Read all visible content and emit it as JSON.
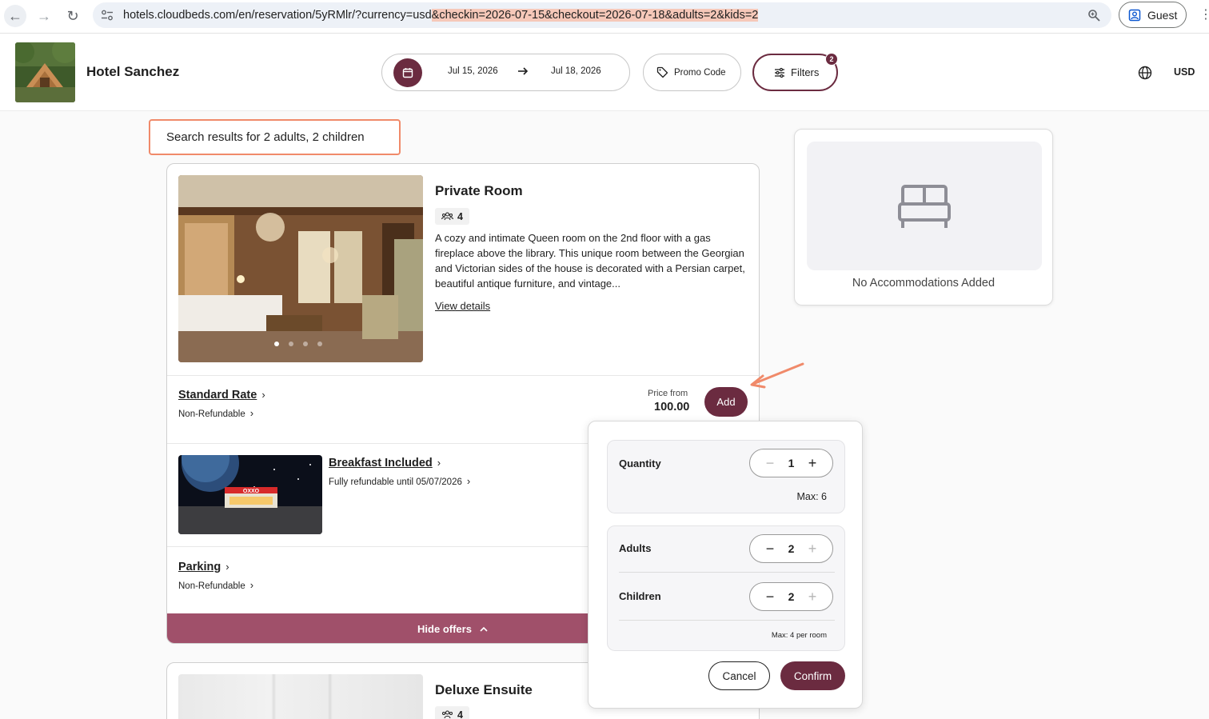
{
  "browser": {
    "url_plain": "hotels.cloudbeds.com/en/reservation/5yRMlr/?currency=usd",
    "url_highlight": "&checkin=2026-07-15&checkout=2026-07-18&adults=2&kids=2",
    "profile_label": "Guest"
  },
  "header": {
    "hotel_name": "Hotel Sanchez",
    "checkin": "Jul 15, 2026",
    "checkout": "Jul 18, 2026",
    "promo_label": "Promo Code",
    "filters_label": "Filters",
    "filters_count": "2",
    "currency": "USD"
  },
  "results": {
    "label": "Search results for 2 adults, 2 children"
  },
  "rooms": [
    {
      "title": "Private Room",
      "occupancy": "4",
      "description": "A cozy and intimate Queen room on the 2nd floor with a gas fireplace above the library. This unique room between the Georgian and Victorian sides of the house is decorated with a Persian carpet, beautiful antique furniture, and vintage...",
      "view_details": "View details",
      "offers": [
        {
          "name": "Standard Rate",
          "policy": "Non-Refundable",
          "price_label": "Price from",
          "price": "100.00",
          "add_label": "Add"
        },
        {
          "name": "Breakfast Included",
          "policy": "Fully refundable until 05/07/2026",
          "photo_sign": "OXXO"
        },
        {
          "name": "Parking",
          "policy": "Non-Refundable"
        }
      ],
      "hide_offers": "Hide offers"
    },
    {
      "title": "Deluxe Ensuite",
      "occupancy": "4"
    }
  ],
  "cart": {
    "empty_message": "No Accommodations Added"
  },
  "popover": {
    "quantity_label": "Quantity",
    "quantity_value": "1",
    "quantity_max": "Max: 6",
    "adults_label": "Adults",
    "adults_value": "2",
    "children_label": "Children",
    "children_value": "2",
    "guests_max": "Max: 4 per room",
    "cancel_label": "Cancel",
    "confirm_label": "Confirm"
  },
  "colors": {
    "brand": "#6b2b40",
    "brand_light": "#a0506a",
    "annotation": "#f08a6a"
  }
}
